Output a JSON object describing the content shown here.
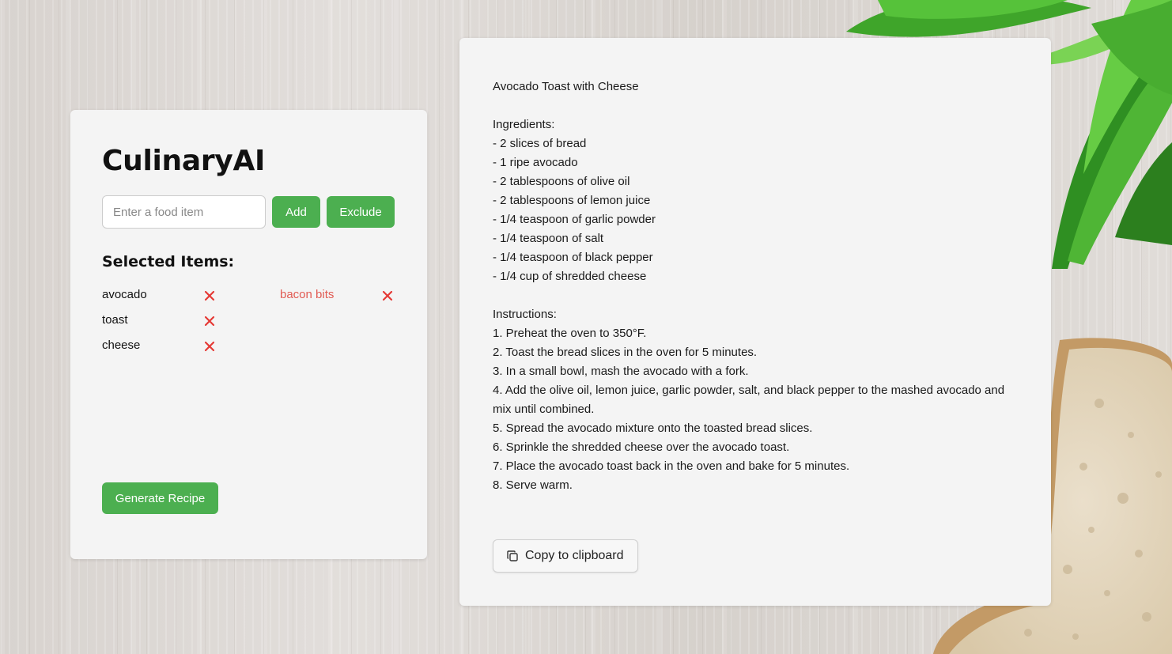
{
  "app": {
    "title": "CulinaryAI"
  },
  "input": {
    "placeholder": "Enter a food item",
    "value": ""
  },
  "buttons": {
    "add": "Add",
    "exclude": "Exclude",
    "generate": "Generate Recipe",
    "copy": "Copy to clipboard"
  },
  "selected": {
    "title": "Selected Items:",
    "included": [
      "avocado",
      "toast",
      "cheese"
    ],
    "excluded": [
      "bacon bits"
    ]
  },
  "recipe": {
    "title": "Avocado Toast with Cheese",
    "ingredients_heading": "Ingredients:",
    "ingredients": [
      "- 2 slices of bread",
      "- 1 ripe avocado",
      "- 2 tablespoons of olive oil",
      "- 2 tablespoons of lemon juice",
      "- 1/4 teaspoon of garlic powder",
      "- 1/4 teaspoon of salt",
      "- 1/4 teaspoon of black pepper",
      "- 1/4 cup of shredded cheese"
    ],
    "instructions_heading": "Instructions:",
    "instructions": [
      "1. Preheat the oven to 350°F.",
      "2. Toast the bread slices in the oven for 5 minutes.",
      "3. In a small bowl, mash the avocado with a fork.",
      "4. Add the olive oil, lemon juice, garlic powder, salt, and black pepper to the mashed avocado and mix until combined.",
      "5. Spread the avocado mixture onto the toasted bread slices.",
      "6. Sprinkle the shredded cheese over the avocado toast.",
      "7. Place the avocado toast back in the oven and bake for 5 minutes.",
      "8. Serve warm."
    ]
  },
  "colors": {
    "accent_green": "#4caf50",
    "remove_red": "#e53935",
    "excluded_text": "#e15a52",
    "card_bg": "#f4f4f4"
  },
  "icons": {
    "remove": "close-icon",
    "copy": "copy-icon"
  }
}
